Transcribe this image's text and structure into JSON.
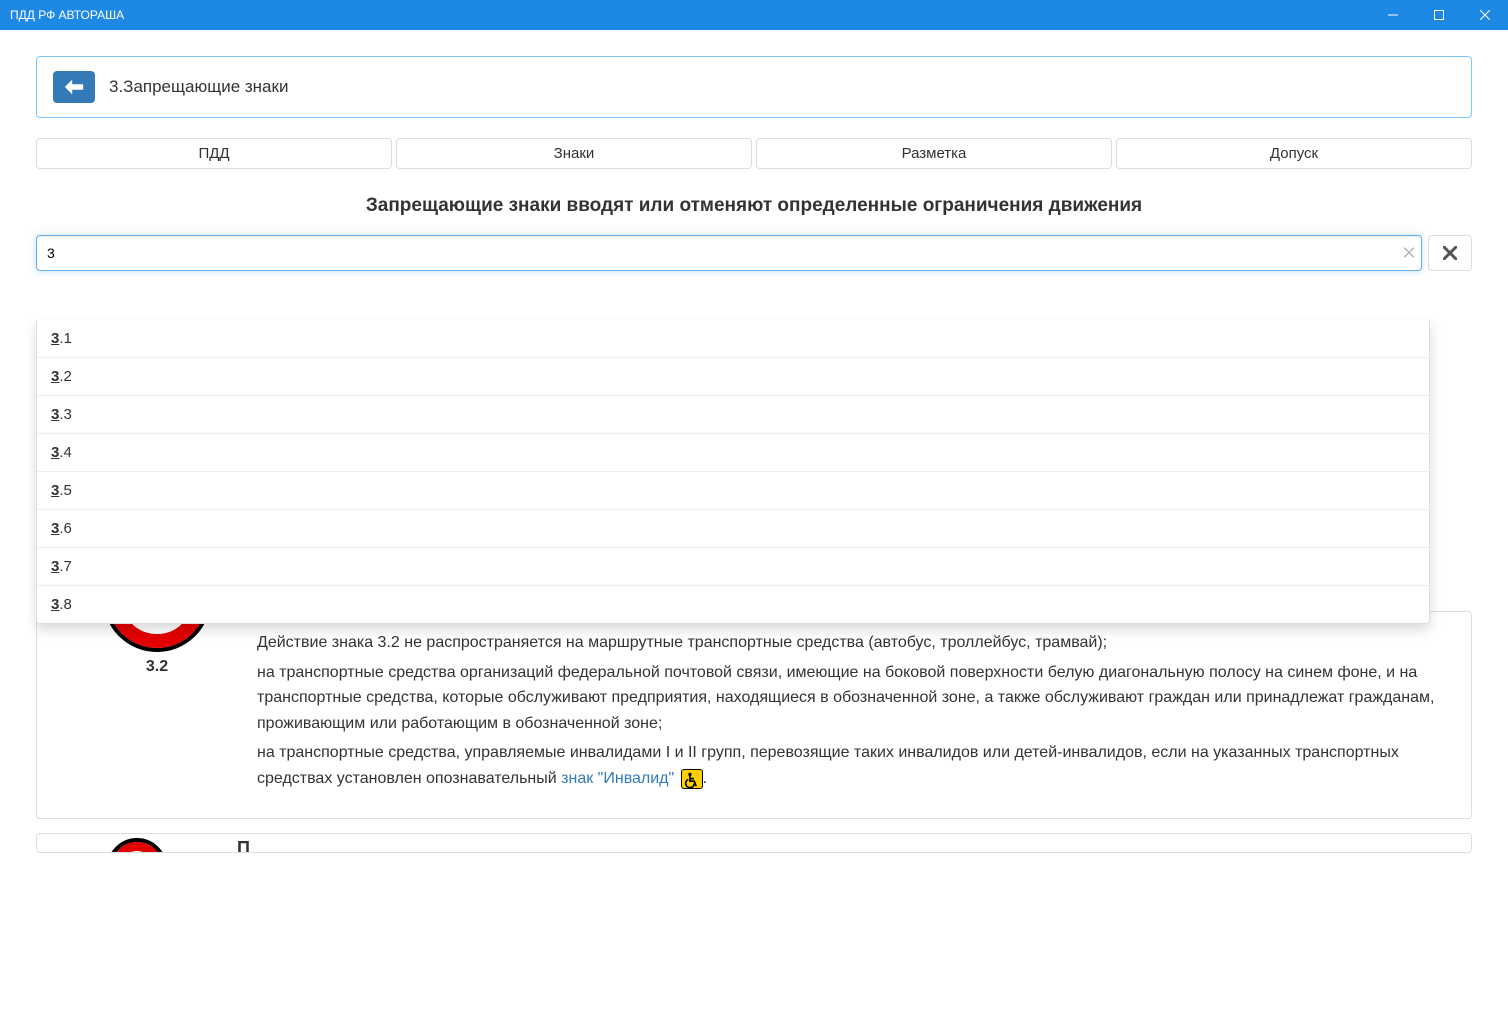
{
  "window": {
    "title": "ПДД РФ АВТОРАША"
  },
  "header": {
    "title": "3.Запрещающие знаки"
  },
  "tabs": [
    "ПДД",
    "Знаки",
    "Разметка",
    "Допуск"
  ],
  "heading": "Запрещающие знаки вводят или отменяют определенные ограничения движения",
  "search": {
    "value": "3",
    "suggestions": [
      {
        "match": "3",
        "rest": ".1"
      },
      {
        "match": "3",
        "rest": ".2"
      },
      {
        "match": "3",
        "rest": ".3"
      },
      {
        "match": "3",
        "rest": ".4"
      },
      {
        "match": "3",
        "rest": ".5"
      },
      {
        "match": "3",
        "rest": ".6"
      },
      {
        "match": "3",
        "rest": ".7"
      },
      {
        "match": "3",
        "rest": ".8"
      }
    ]
  },
  "article": {
    "sign_number": "3.2",
    "p1": "Действие знака 3.2 не распространяется на маршрутные транспортные средства (автобус, троллейбус, трамвай);",
    "p2": "на транспортные средства организаций федеральной почтовой связи, имеющие на боковой поверхности белую диагональную полосу на синем фоне, и на транспортные средства, которые обслуживают предприятия, находящиеся в обозначенной зоне, а также обслуживают граждан или принадлежат гражданам, проживающим или работающим в обозначенной зоне;",
    "p3a": "на транспортные средства, управляемые инвалидами I и II групп, перевозящие таких инвалидов или детей-инвалидов, если на указанных транспортных средствах установлен опознавательный ",
    "link_text": "знак \"Инвалид\"",
    "p3b": "."
  },
  "next_article": {
    "label": "П"
  }
}
